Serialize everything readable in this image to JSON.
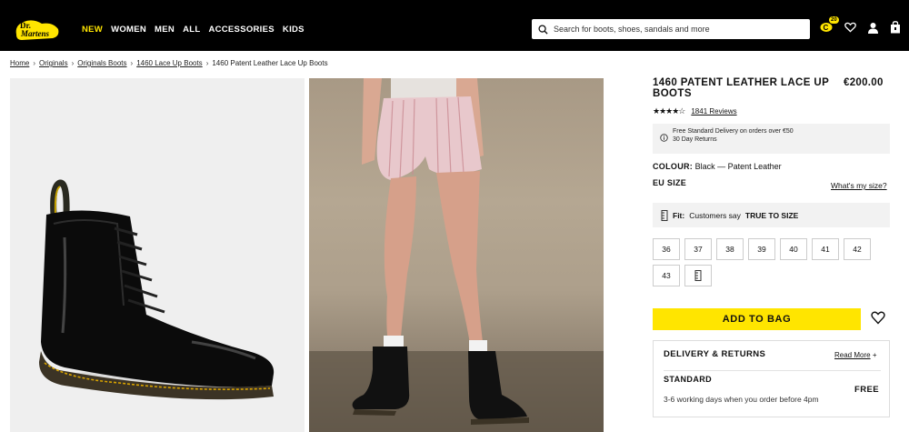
{
  "header": {
    "nav": [
      "NEW",
      "WOMEN",
      "MEN",
      "ALL",
      "ACCESSORIES",
      "KIDS"
    ],
    "search_placeholder": "Search for boots, shoes, sandals and more",
    "points_badge": "20",
    "icons": [
      "coin-icon",
      "heart-icon",
      "user-icon",
      "bag-icon"
    ]
  },
  "breadcrumb": [
    "Home",
    "Originals",
    "Originals Boots",
    "1460 Lace Up Boots",
    "1460 Patent Leather Lace Up Boots"
  ],
  "product": {
    "title": "1460 PATENT LEATHER LACE UP BOOTS",
    "price": "€200.00",
    "stars": "★★★★☆",
    "rating": 4.5,
    "reviews": "1841 Reviews",
    "info_line1": "Free Standard Delivery on orders over €50",
    "info_line2": "30 Day Returns",
    "colour_label": "COLOUR:",
    "colour_value": "Black — Patent Leather",
    "size_label": "EU SIZE",
    "size_help": "What's my size?",
    "fit_label": "Fit:",
    "fit_text": "Customers say",
    "fit_value": "TRUE TO SIZE",
    "sizes": [
      "36",
      "37",
      "38",
      "39",
      "40",
      "41",
      "42",
      "43"
    ],
    "add_to_bag": "ADD TO BAG"
  },
  "delivery": {
    "title": "DELIVERY & RETURNS",
    "read_more": "Read More",
    "read_more_icon": "+",
    "standard": "STANDARD",
    "standard_days": "3-6 working days when you order before 4pm",
    "standard_price": "FREE"
  },
  "colors": {
    "accent": "#ffe500",
    "header_bg": "#000000",
    "panel_bg": "#f2f2f2"
  }
}
